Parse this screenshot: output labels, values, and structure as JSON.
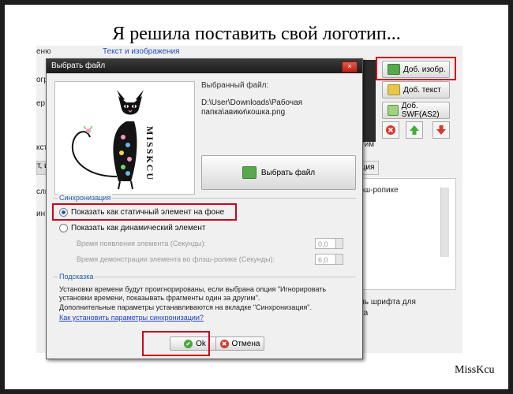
{
  "headline": "Я решила поставить свой логотип...",
  "signature": "MissKcu",
  "background_app": {
    "menu_fragment": "еню",
    "tab_text_images": "Текст и изображения",
    "left_fragments": [
      "огра",
      "ер",
      "кст",
      "т, и",
      "сль",
      "ин"
    ],
    "right_fragments": [
      "гим",
      "кация",
      "эш-ропике",
      "ль шрифта для",
      "ка"
    ],
    "btn_add_image": "Доб. изобр.",
    "btn_add_text": "Доб. текст",
    "btn_add_swf": "Доб. SWF(AS2)"
  },
  "dialog": {
    "title": "Выбрать файл",
    "close_glyph": "×",
    "selected_file_label": "Выбранный файл:",
    "selected_file_path": "D:\\User\\Downloads\\Рабочая\nпапка\\авики\\кошка.png",
    "choose_file_button": "Выбрать файл",
    "logo_text": "MISSKCU",
    "sync_group_title": "Синхронизация",
    "radio_static": "Показать как статичный элемент на фоне",
    "radio_dynamic": "Показать как динамический элемент",
    "appear_time_label": "Время появления элемента (Секунды):",
    "appear_time_value": "0,0",
    "show_time_label": "Время демонстрации элемента во флэш-ролике (Секунды):",
    "show_time_value": "6,0",
    "hint_group_title": "Подсказка",
    "hint_line1": "Установки времени будут проигнорированы, если выбрана опция \"Игнорировать установки времени, показывать фрагменты один за другим\".",
    "hint_line2": "Дополнительные параметры устанавливаются на вкладке \"Синхронизация\".",
    "hint_link": "Как установить параметры синхронизации?",
    "ok_button": "Ok",
    "cancel_button": "Отмена"
  }
}
